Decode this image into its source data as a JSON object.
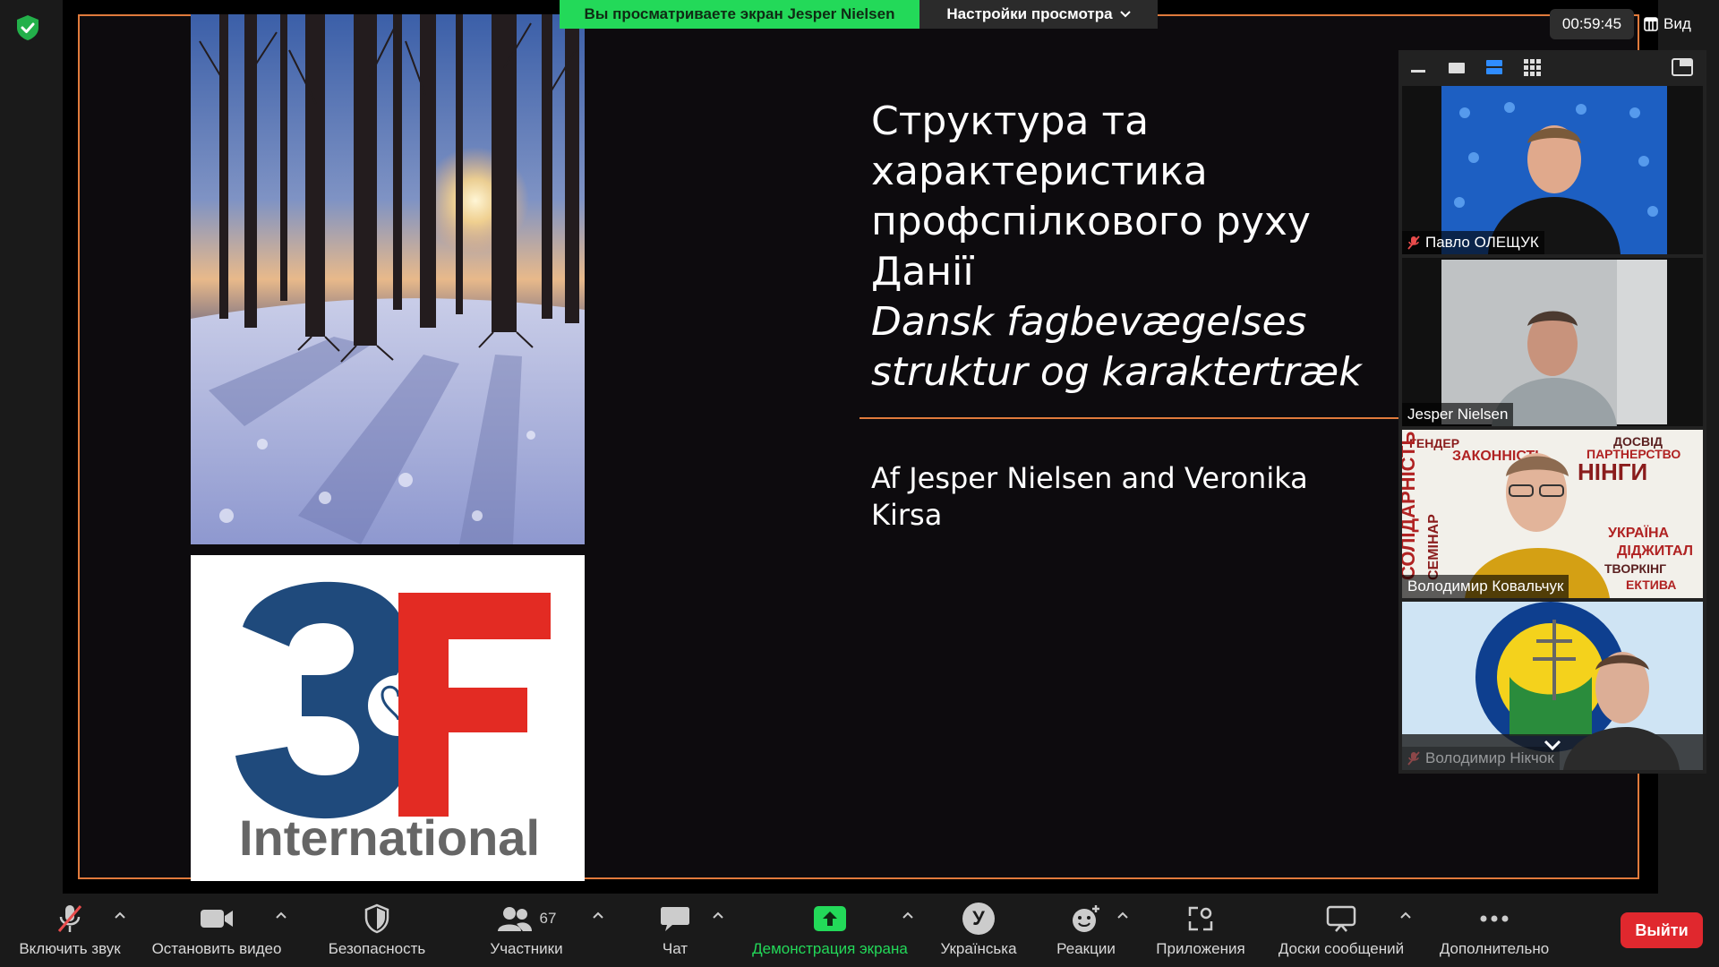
{
  "top_bar": {
    "share_banner": "Вы просматриваете экран Jesper Nielsen",
    "view_options_label": "Настройки просмотра",
    "timer": "00:59:45",
    "view_label": "Вид"
  },
  "slide": {
    "title_lines": [
      "Структура та",
      "характеристика",
      "профспілкового руху",
      "Данії"
    ],
    "subtitle_lines": [
      "Dansk fagbevægelses",
      "struktur og karaktertræk"
    ],
    "author_lines": [
      "Af Jesper Nielsen and Veronika",
      "Kirsa"
    ],
    "logo_text": "3F",
    "logo_subtext": "International"
  },
  "participants": [
    {
      "name": "Павло ОЛЕЩУК",
      "muted": true
    },
    {
      "name": "Jesper Nielsen",
      "muted": false,
      "active_speaker": true
    },
    {
      "name": "Володимир Ковальчук",
      "muted": false
    },
    {
      "name": "Володимир Нікчок",
      "muted": true
    }
  ],
  "toolbar": {
    "mute_label": "Включить звук",
    "video_label": "Остановить видео",
    "security_label": "Безопасность",
    "participants_label": "Участники",
    "participants_count": "67",
    "chat_label": "Чат",
    "share_label": "Демонстрация экрана",
    "language_label": "Українська",
    "language_avatar": "У",
    "reactions_label": "Реакции",
    "apps_label": "Приложения",
    "whiteboards_label": "Доски сообщений",
    "more_label": "Дополнительно",
    "leave_label": "Выйти"
  },
  "colors": {
    "share_green": "#23d959",
    "slide_accent": "#e07a3c",
    "leave_red": "#e0282e",
    "logo_blue": "#1f4a7c",
    "logo_red": "#e32b23",
    "active_speaker_border": "#8ad25a"
  }
}
